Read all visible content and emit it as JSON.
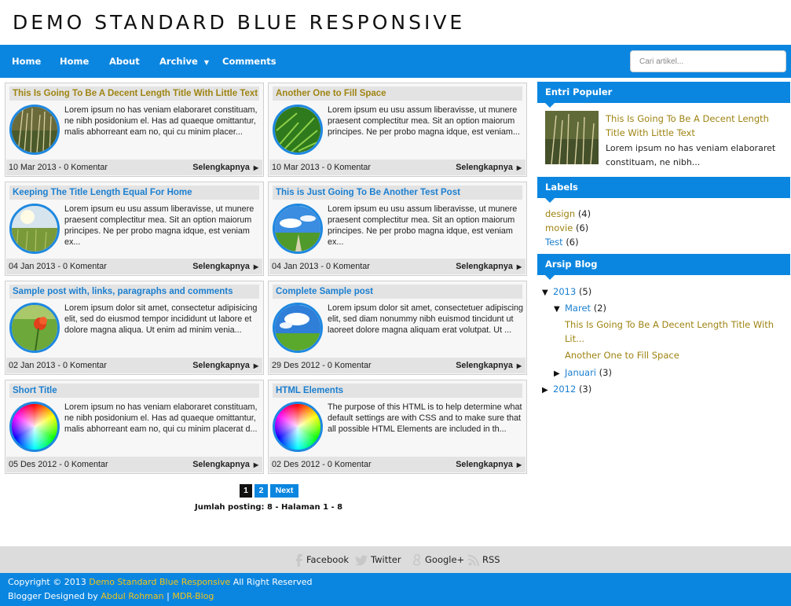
{
  "header": {
    "site_title": "DEMO STANDARD BLUE RESPONSIVE"
  },
  "nav": {
    "items": [
      "Home",
      "Home",
      "About",
      "Archive",
      "Comments"
    ],
    "search_placeholder": "Cari artikel..."
  },
  "posts": [
    {
      "title": "This Is Going To Be A Decent Length Title With Little Text",
      "snippet": "Lorem ipsum no has veniam elaboraret constituam, ne nibh posidonium el. Has ad quaeque omittantur, malis abhorreant eam no, qui cu minim placer...",
      "date": "10 Mar 2013 - 0 Komentar",
      "read_more": "Selengkapnya",
      "thumb": "grass"
    },
    {
      "title": "Another One to Fill Space",
      "snippet": "Lorem ipsum eu usu assum liberavisse, ut munere praesent complectitur mea. Sit an option maiorum principes. Ne per probo magna idque, est veniam...",
      "date": "10 Mar 2013 - 0 Komentar",
      "read_more": "Selengkapnya",
      "thumb": "green-grass"
    },
    {
      "title": "Keeping The Title Length Equal For Home",
      "snippet": "Lorem ipsum eu usu assum liberavisse, ut munere praesent complectitur mea. Sit an option maiorum principes. Ne per probo magna idque, est veniam ex...",
      "date": "04 Jan 2013 - 0 Komentar",
      "read_more": "Selengkapnya",
      "thumb": "field"
    },
    {
      "title": "This is Just Going To Be Another Test Post",
      "snippet": "Lorem ipsum eu usu assum liberavisse, ut munere praesent complectitur mea. Sit an option maiorum principes. Ne per probo magna idque, est veniam ex...",
      "date": "04 Jan 2013 - 0 Komentar",
      "read_more": "Selengkapnya",
      "thumb": "sky-road"
    },
    {
      "title": "Sample post with, links, paragraphs and comments",
      "snippet": "Lorem ipsum dolor sit amet, consectetur adipisicing elit, sed do eiusmod tempor incididunt ut labore et dolore magna aliqua. Ut enim ad minim venia...",
      "date": "02 Jan 2013 - 0 Komentar",
      "read_more": "Selengkapnya",
      "thumb": "poppy"
    },
    {
      "title": "Complete Sample post",
      "snippet": "Lorem ipsum dolor sit amet, consectetuer adipiscing elit, sed diam nonummy nibh euismod tincidunt ut laoreet dolore magna aliquam erat volutpat. Ut ...",
      "date": "29 Des 2012 - 0 Komentar",
      "read_more": "Selengkapnya",
      "thumb": "sky-field"
    },
    {
      "title": "Short Title",
      "snippet": "Lorem ipsum no has veniam elaboraret constituam, ne nibh posidonium el. Has ad quaeque omittantur, malis abhorreant eam no, qui cu minim placerat d...",
      "date": "05 Des 2012 - 0 Komentar",
      "read_more": "Selengkapnya",
      "thumb": "color-wheel"
    },
    {
      "title": "HTML Elements",
      "snippet": "The purpose of this HTML is to help determine what default settings are with CSS and to make sure that all possible HTML Elements are included in th...",
      "date": "02 Des 2012 - 0 Komentar",
      "read_more": "Selengkapnya",
      "thumb": "color-wheel"
    }
  ],
  "pagination": {
    "pages": [
      "1",
      "2"
    ],
    "next": "Next",
    "current": "1",
    "summary": "Jumlah posting: 8 - Halaman 1 - 8"
  },
  "sidebar": {
    "popular": {
      "title": "Entri Populer",
      "post_title": "This Is Going To Be A Decent Length Title With Little Text",
      "snippet": "Lorem ipsum no has veniam elaboraret constituam, ne nibh..."
    },
    "labels": {
      "title": "Labels",
      "items": [
        {
          "name": "design",
          "count": "(4)"
        },
        {
          "name": "movie",
          "count": "(6)"
        },
        {
          "name": "Test",
          "count": "(6)"
        }
      ]
    },
    "archive": {
      "title": "Arsip Blog",
      "year_2013": "2013",
      "year_2013_count": "(5)",
      "month_maret": "Maret",
      "month_maret_count": "(2)",
      "posts": [
        "This Is Going To Be A Decent Length Title With Lit...",
        "Another One to Fill Space"
      ],
      "month_januari": "Januari",
      "month_januari_count": "(3)",
      "year_2012": "2012",
      "year_2012_count": "(3)"
    }
  },
  "social": {
    "links": [
      "Facebook",
      "Twitter",
      "Google+",
      "RSS"
    ]
  },
  "footer": {
    "copyright_prefix": "Copyright © 2013",
    "site_link": "Demo Standard Blue Responsive",
    "rights": "All Right Reserved",
    "designed_by": "Blogger Designed by",
    "author": "Abdul Rohman",
    "separator": "|",
    "blog": "MDR-Blog"
  },
  "colors": {
    "accent": "#0b86e0",
    "title_gold": "#9f8413",
    "link_blue": "#1b7fd0",
    "footer_link": "#f0c419"
  }
}
